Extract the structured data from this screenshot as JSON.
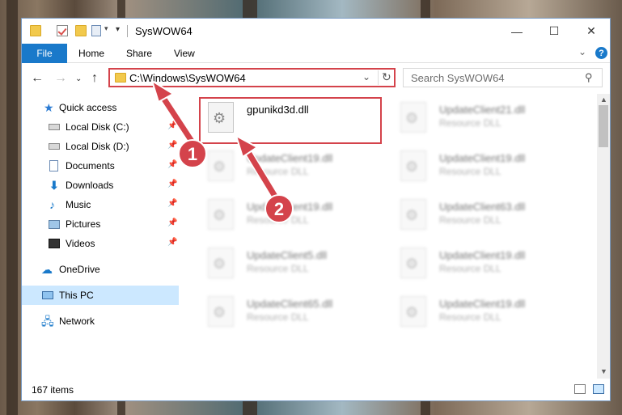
{
  "window": {
    "title": "SysWOW64",
    "controls": {
      "minimize": "—",
      "maximize": "☐",
      "close": "✕"
    }
  },
  "ribbon": {
    "tabs": [
      "File",
      "Home",
      "Share",
      "View"
    ],
    "help": "?",
    "collapse_icon": "chevron-down-icon"
  },
  "nav": {
    "back_icon": "arrow-left-icon",
    "forward_icon": "arrow-right-icon",
    "recent_icon": "chevron-down-icon",
    "up_icon": "arrow-up-icon",
    "address": "C:\\Windows\\SysWOW64",
    "search_placeholder": "Search SysWOW64"
  },
  "sidebar": {
    "items": [
      {
        "label": "Quick access",
        "icon": "star-icon",
        "pinned": false
      },
      {
        "label": "Local Disk (C:)",
        "icon": "drive-icon",
        "pinned": true
      },
      {
        "label": "Local Disk (D:)",
        "icon": "drive-icon",
        "pinned": true
      },
      {
        "label": "Documents",
        "icon": "document-icon",
        "pinned": true
      },
      {
        "label": "Downloads",
        "icon": "download-icon",
        "pinned": true
      },
      {
        "label": "Music",
        "icon": "music-icon",
        "pinned": true
      },
      {
        "label": "Pictures",
        "icon": "pictures-icon",
        "pinned": true
      },
      {
        "label": "Videos",
        "icon": "video-icon",
        "pinned": true
      },
      {
        "label": "OneDrive",
        "icon": "cloud-icon",
        "pinned": false
      },
      {
        "label": "This PC",
        "icon": "computer-icon",
        "pinned": false,
        "selected": true
      },
      {
        "label": "Network",
        "icon": "network-icon",
        "pinned": false
      }
    ]
  },
  "files": {
    "highlighted": {
      "name": "gpunikd3d.dll",
      "desc": ""
    },
    "left_column": [
      {
        "name": "UpdateClient19.dll",
        "desc": "Resource DLL"
      },
      {
        "name": "UpdateClient19.dll",
        "desc": "Resource DLL"
      },
      {
        "name": "UpdateClient5.dll",
        "desc": "Resource DLL"
      },
      {
        "name": "UpdateClient65.dll",
        "desc": "Resource DLL"
      }
    ],
    "right_column": [
      {
        "name": "UpdateClient21.dll",
        "desc": "Resource DLL"
      },
      {
        "name": "UpdateClient19.dll",
        "desc": "Resource DLL"
      },
      {
        "name": "UpdateClient63.dll",
        "desc": "Resource DLL"
      },
      {
        "name": "UpdateClient19.dll",
        "desc": "Resource DLL"
      },
      {
        "name": "UpdateClient19.dll",
        "desc": "Resource DLL"
      }
    ]
  },
  "status": {
    "item_count": "167 items"
  },
  "annotations": {
    "step1": "1",
    "step2": "2",
    "color": "#d4434b"
  },
  "colors": {
    "accent": "#1979ca",
    "selection": "#cce8ff",
    "annotation_red": "#d4434b"
  }
}
